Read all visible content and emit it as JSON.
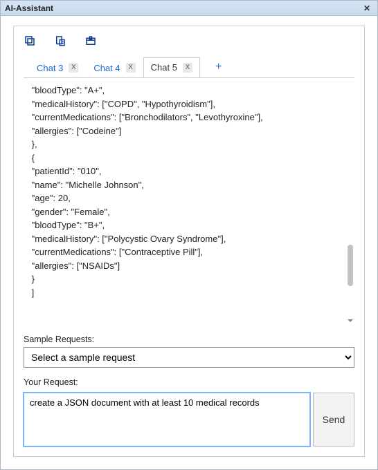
{
  "title": "AI-Assistant",
  "close_glyph": "✕",
  "tabs": [
    {
      "label": "Chat 3",
      "close": "X",
      "active": false
    },
    {
      "label": "Chat 4",
      "close": "X",
      "active": false
    },
    {
      "label": "Chat 5",
      "close": "X",
      "active": true
    }
  ],
  "tab_add": "+",
  "code_text": " \"bloodType\": \"A+\",\n \"medicalHistory\": [\"COPD\", \"Hypothyroidism\"],\n \"currentMedications\": [\"Bronchodilators\", \"Levothyroxine\"],\n \"allergies\": [\"Codeine\"]\n },\n {\n \"patientId\": \"010\",\n \"name\": \"Michelle Johnson\",\n \"age\": 20,\n \"gender\": \"Female\",\n \"bloodType\": \"B+\",\n \"medicalHistory\": [\"Polycystic Ovary Syndrome\"],\n \"currentMedications\": [\"Contraceptive Pill\"],\n \"allergies\": [\"NSAIDs\"]\n }\n ]",
  "sample_label": "Sample Requests:",
  "sample_placeholder": "Select a sample request",
  "request_label": "Your Request:",
  "request_value": "create a JSON document with at least 10 medical records",
  "send_label": "Send"
}
